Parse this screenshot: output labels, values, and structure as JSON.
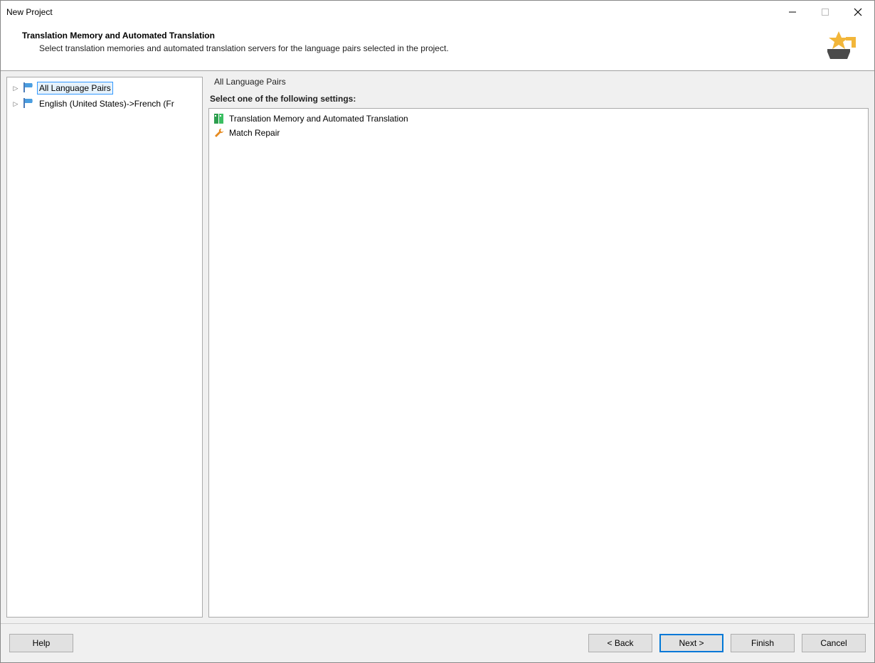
{
  "window": {
    "title": "New Project"
  },
  "header": {
    "title": "Translation Memory and Automated Translation",
    "subtitle": "Select translation memories and automated translation servers for the language pairs selected in the project."
  },
  "tree": {
    "items": [
      {
        "label": "All Language Pairs",
        "selected": true
      },
      {
        "label": "English (United States)->French (Fr",
        "selected": false
      }
    ]
  },
  "settings": {
    "group_label": "All Language Pairs",
    "prompt": "Select one of the following settings:",
    "items": [
      {
        "label": "Translation Memory and Automated Translation"
      },
      {
        "label": "Match Repair"
      }
    ]
  },
  "buttons": {
    "help": "Help",
    "back": "< Back",
    "next": "Next >",
    "finish": "Finish",
    "cancel": "Cancel"
  }
}
